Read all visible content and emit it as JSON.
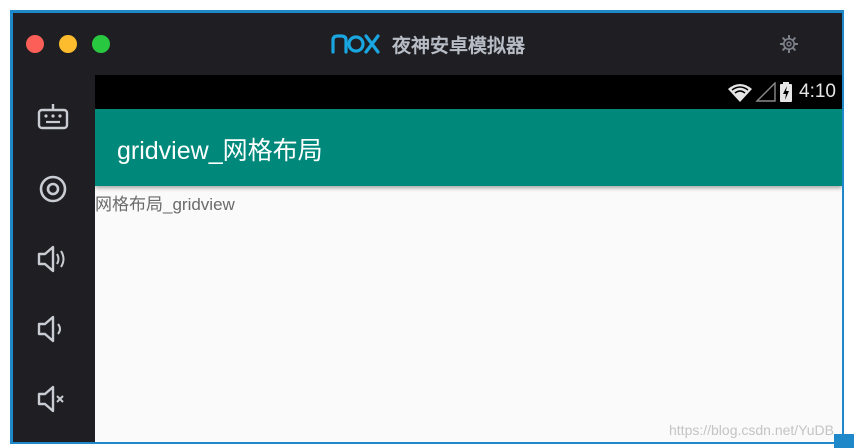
{
  "window": {
    "app_name": "夜神安卓模拟器",
    "logo_text": "nox",
    "accent_color": "#1e88c8"
  },
  "sidebar": {
    "items": [
      {
        "icon": "keyboard-icon"
      },
      {
        "icon": "location-icon"
      },
      {
        "icon": "volume-up-icon"
      },
      {
        "icon": "volume-down-icon"
      },
      {
        "icon": "volume-mute-icon"
      }
    ]
  },
  "android": {
    "status_bar": {
      "time": "4:10",
      "icons": [
        "wifi-icon",
        "signal-icon",
        "battery-charging-icon"
      ]
    },
    "app_bar": {
      "title": "gridview_网格布局",
      "color": "#00897b"
    },
    "content": {
      "text": "网格布局_gridview"
    }
  },
  "watermark": "https://blog.csdn.net/YuDB"
}
